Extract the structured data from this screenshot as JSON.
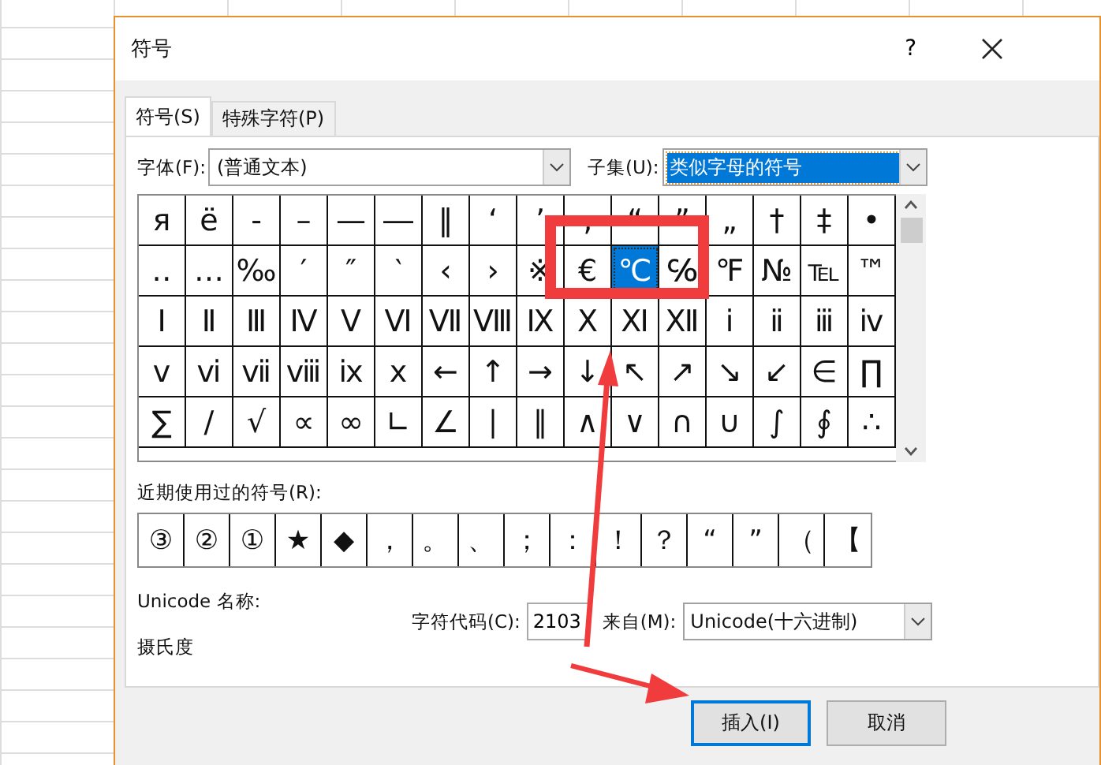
{
  "dialog": {
    "title": "符号",
    "help": "?"
  },
  "tabs": [
    {
      "label": "符号(S)",
      "selected": true
    },
    {
      "label": "特殊字符(P)",
      "selected": false
    }
  ],
  "font": {
    "label": "字体(F):",
    "value": "(普通文本)"
  },
  "subset": {
    "label": "子集(U):",
    "value": "类似字母的符号",
    "selected": true
  },
  "symbols": [
    [
      {
        "ch": "я"
      },
      {
        "ch": "ё"
      },
      {
        "ch": "-"
      },
      {
        "ch": "–"
      },
      {
        "ch": "—"
      },
      {
        "ch": "―"
      },
      {
        "ch": "‖"
      },
      {
        "ch": "‘"
      },
      {
        "ch": "’"
      },
      {
        "ch": "‚"
      },
      {
        "ch": "“"
      },
      {
        "ch": "”"
      },
      {
        "ch": "„"
      },
      {
        "ch": "†"
      },
      {
        "ch": "‡"
      },
      {
        "ch": "•"
      }
    ],
    [
      {
        "ch": "‥"
      },
      {
        "ch": "…"
      },
      {
        "ch": "‰"
      },
      {
        "ch": "′"
      },
      {
        "ch": "″"
      },
      {
        "ch": "‵"
      },
      {
        "ch": "‹"
      },
      {
        "ch": "›"
      },
      {
        "ch": "※"
      },
      {
        "ch": "€"
      },
      {
        "ch": "℃",
        "selected": true
      },
      {
        "ch": "℅"
      },
      {
        "ch": "℉"
      },
      {
        "ch": "№"
      },
      {
        "ch": "℡"
      },
      {
        "ch": "™"
      }
    ],
    [
      {
        "ch": "Ⅰ"
      },
      {
        "ch": "Ⅱ"
      },
      {
        "ch": "Ⅲ"
      },
      {
        "ch": "Ⅳ"
      },
      {
        "ch": "Ⅴ"
      },
      {
        "ch": "Ⅵ"
      },
      {
        "ch": "Ⅶ"
      },
      {
        "ch": "Ⅷ"
      },
      {
        "ch": "Ⅸ"
      },
      {
        "ch": "Ⅹ"
      },
      {
        "ch": "Ⅺ"
      },
      {
        "ch": "Ⅻ"
      },
      {
        "ch": "ⅰ"
      },
      {
        "ch": "ⅱ"
      },
      {
        "ch": "ⅲ"
      },
      {
        "ch": "ⅳ"
      }
    ],
    [
      {
        "ch": "ⅴ"
      },
      {
        "ch": "ⅵ"
      },
      {
        "ch": "ⅶ"
      },
      {
        "ch": "ⅷ"
      },
      {
        "ch": "ⅸ"
      },
      {
        "ch": "ⅹ"
      },
      {
        "ch": "←"
      },
      {
        "ch": "↑"
      },
      {
        "ch": "→"
      },
      {
        "ch": "↓"
      },
      {
        "ch": "↖"
      },
      {
        "ch": "↗"
      },
      {
        "ch": "↘"
      },
      {
        "ch": "↙"
      },
      {
        "ch": "∈"
      },
      {
        "ch": "∏"
      }
    ],
    [
      {
        "ch": "∑"
      },
      {
        "ch": "∕"
      },
      {
        "ch": "√"
      },
      {
        "ch": "∝"
      },
      {
        "ch": "∞"
      },
      {
        "ch": "∟"
      },
      {
        "ch": "∠"
      },
      {
        "ch": "∣"
      },
      {
        "ch": "∥"
      },
      {
        "ch": "∧"
      },
      {
        "ch": "∨"
      },
      {
        "ch": "∩"
      },
      {
        "ch": "∪"
      },
      {
        "ch": "∫"
      },
      {
        "ch": "∮"
      },
      {
        "ch": "∴"
      }
    ]
  ],
  "recent": {
    "label": "近期使用过的符号(R):",
    "symbols": [
      "③",
      "②",
      "①",
      "★",
      "◆",
      "，",
      "。",
      "、",
      "；",
      "：",
      "！",
      "？",
      "“",
      "”",
      "（",
      "【"
    ]
  },
  "unicode_name": {
    "label": "Unicode 名称:",
    "value": "摄氏度"
  },
  "char_code": {
    "label": "字符代码(C):",
    "value": "2103"
  },
  "from": {
    "label": "来自(M):",
    "value": "Unicode(十六进制)"
  },
  "buttons": [
    {
      "label": "插入(I)",
      "default": true
    },
    {
      "label": "取消",
      "default": false
    }
  ]
}
